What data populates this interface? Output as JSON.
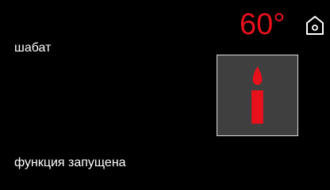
{
  "header": {
    "temperature": "60°",
    "temperature_color": "#e8111b",
    "home_icon": "home-icon"
  },
  "mode": {
    "label": "шабат",
    "icon": "candle-icon",
    "icon_color": "#e8111b"
  },
  "status": {
    "text": "функция запущена"
  }
}
